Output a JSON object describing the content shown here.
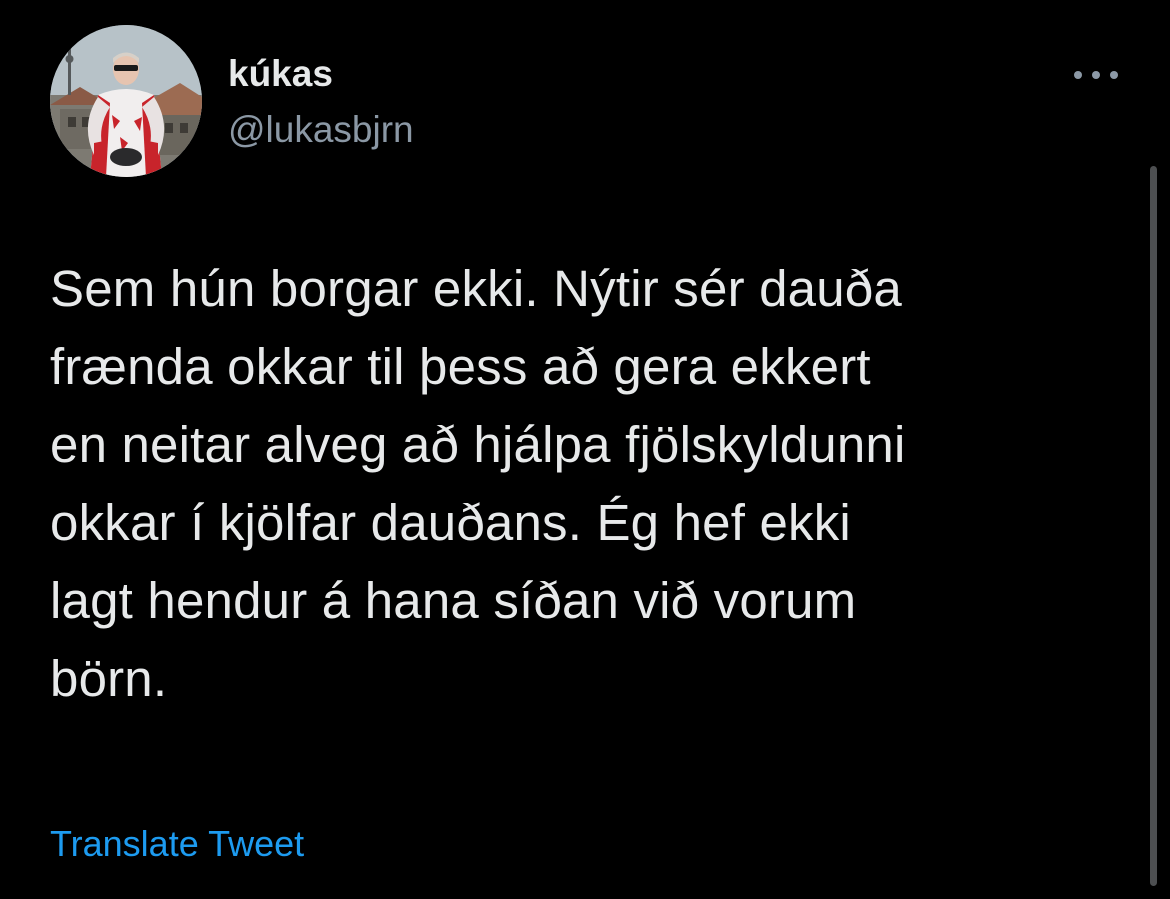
{
  "author": {
    "display_name": "kúkas",
    "handle": "@lukasbjrn",
    "avatar_icon": "profile-photo"
  },
  "more_icon": "more-horizontal-icon",
  "tweet": {
    "text": "Sem hún borgar ekki. Nýtir sér dauða\nfrænda okkar til þess að gera ekkert\nen neitar alveg að hjálpa fjölskyldunni\nokkar í kjölfar dauðans. Ég hef ekki\nlagt hendur á hana síðan við vorum\nbörn."
  },
  "translate_label": "Translate Tweet",
  "colors": {
    "background": "#000000",
    "primary_text": "#e7e9ea",
    "secondary_text": "#8b98a5",
    "link": "#1d9bf0"
  }
}
